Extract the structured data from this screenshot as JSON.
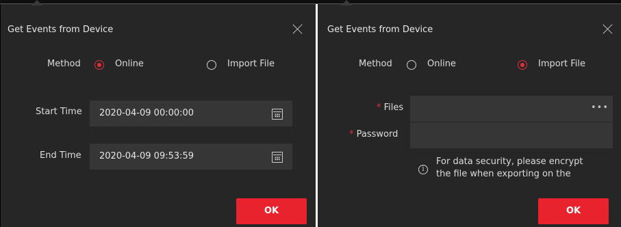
{
  "left_dialog": {
    "title": "Get Events from Device",
    "method_label": "Method",
    "options": [
      "Online",
      "Import File"
    ],
    "selected": "Online",
    "start_label": "Start Time",
    "start_value": "2020-04-09 00:00:00",
    "end_label": "End Time",
    "end_value": "2020-04-09 09:53:59",
    "ok_label": "OK"
  },
  "right_dialog": {
    "title": "Get Events from Device",
    "method_label": "Method",
    "options": [
      "Online",
      "Import File"
    ],
    "selected": "Import File",
    "required_mark": "*",
    "files_label": "Files",
    "files_browse": "•••",
    "password_label": "Password",
    "note_line1": "For data security, please encrypt",
    "note_line2": "the file when exporting on the",
    "ok_label": "OK"
  },
  "icons": {
    "close": "close-icon",
    "calendar": "calendar-icon",
    "info": "info-icon"
  },
  "colors": {
    "accent": "#e8232d",
    "panel_bg": "#262626",
    "field_bg": "#363636"
  }
}
